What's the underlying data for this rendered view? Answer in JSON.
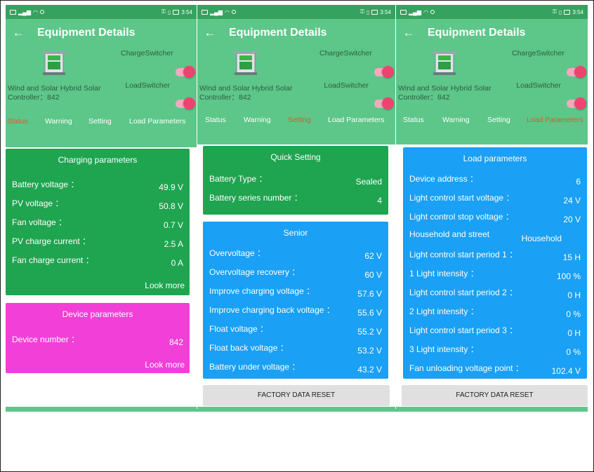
{
  "status_bar": {
    "time": "3:54"
  },
  "app_bar": {
    "title": "Equipment Details"
  },
  "device": {
    "name": "Wind and Solar Hybrid Solar Controller：842",
    "charge_switch_label": "ChargeSwitcher",
    "load_switch_label": "LoadSwitcher"
  },
  "tabs": [
    "Status",
    "Warning",
    "Setting",
    "Load Parameters"
  ],
  "screen1": {
    "active_tab": "Status",
    "charging": {
      "title": "Charging parameters",
      "rows": [
        {
          "label": "Battery voltage ：",
          "value": "49.9 V"
        },
        {
          "label": "PV voltage ：",
          "value": "50.8 V"
        },
        {
          "label": "Fan voltage ：",
          "value": "0.7 V"
        },
        {
          "label": "PV charge current ：",
          "value": "2.5 A"
        },
        {
          "label": "Fan charge current ：",
          "value": "0 A"
        }
      ],
      "look_more": "Look more"
    },
    "device_params": {
      "title": "Device parameters",
      "rows": [
        {
          "label": "Device number ：",
          "value": "842"
        }
      ],
      "look_more": "Look more"
    }
  },
  "screen2": {
    "active_tab": "Setting",
    "quick": {
      "title": "Quick Setting",
      "rows": [
        {
          "label": "Battery Type ：",
          "value": "Sealed"
        },
        {
          "label": "Battery series number ：",
          "value": "4"
        }
      ]
    },
    "senior": {
      "title": "Senior",
      "rows": [
        {
          "label": "Overvoltage ：",
          "value": "62 V"
        },
        {
          "label": "Overvoltage recovery ：",
          "value": "60 V"
        },
        {
          "label": "Improve charging voltage ：",
          "value": "57.6 V"
        },
        {
          "label": "Improve charging back voltage ：",
          "value": "55.6 V"
        },
        {
          "label": "Float voltage ：",
          "value": "55.2 V"
        },
        {
          "label": "Float back voltage ：",
          "value": "53.2 V"
        },
        {
          "label": "Battery under voltage ：",
          "value": "43.2 V"
        }
      ]
    },
    "reset_label": "FACTORY DATA RESET"
  },
  "screen3": {
    "active_tab": "Load Parameters",
    "load": {
      "title": "Load parameters",
      "rows": [
        {
          "label": "Device address ：",
          "value": "6"
        },
        {
          "label": "Light control start voltage ：",
          "value": "24 V"
        },
        {
          "label": "Light control stop voltage ：",
          "value": "20 V"
        },
        {
          "label": "Household and street",
          "value": "Household"
        },
        {
          "label": "Light control start period 1 ：",
          "value": "15 H"
        },
        {
          "label": "1 Light intensity ：",
          "value": "100 %"
        },
        {
          "label": "Light control start period 2 ：",
          "value": "0 H"
        },
        {
          "label": "2 Light intensity ：",
          "value": "0 %"
        },
        {
          "label": "Light control start period 3 ：",
          "value": "0 H"
        },
        {
          "label": "3 Light intensity ：",
          "value": "0 %"
        },
        {
          "label": "Fan unloading voltage point ：",
          "value": "102.4 V"
        }
      ]
    },
    "reset_label": "FACTORY DATA RESET"
  },
  "colors": {
    "app_green": "#5dc689",
    "status_green": "#35a25f",
    "card_green": "#1fa450",
    "card_pink": "#f23fd7",
    "card_blue": "#1aa0f5",
    "active_tab": "#e8542f",
    "toggle_on": "#f0426f"
  }
}
